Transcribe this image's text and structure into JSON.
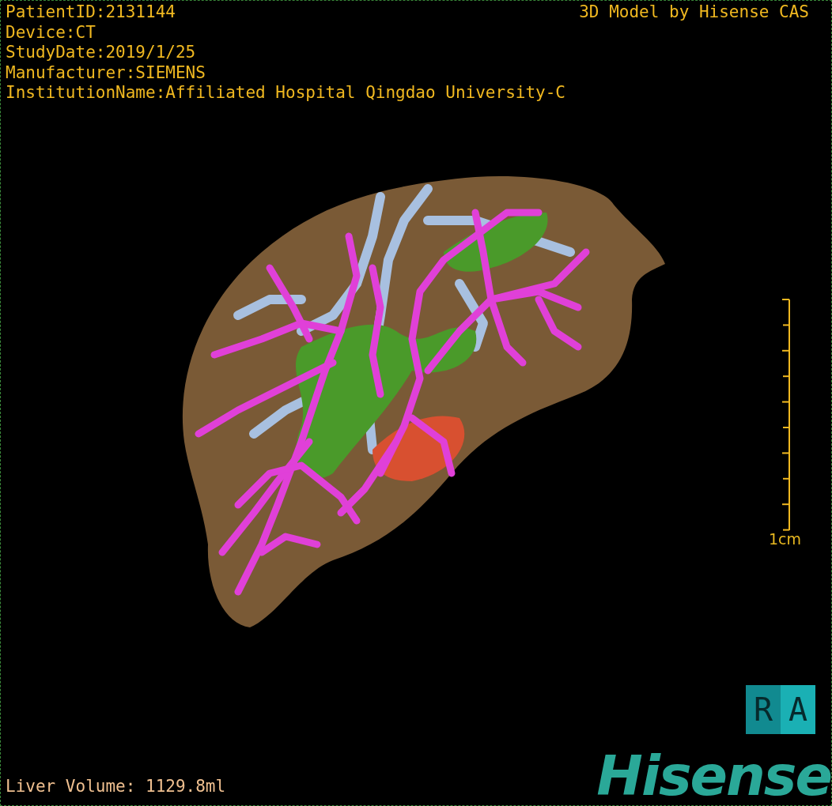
{
  "info_lines": [
    "PatientID:2131144",
    "Device:CT",
    "StudyDate:2019/1/25",
    "Manufacturer:SIEMENS",
    "InstitutionName:Affiliated Hospital Qingdao University-C"
  ],
  "credit": "3D Model by Hisense CAS",
  "scale": {
    "label": "1cm"
  },
  "orientation_labels": [
    "R",
    "A"
  ],
  "volume": "Liver Volume: 1129.8ml",
  "logo": "Hisense"
}
